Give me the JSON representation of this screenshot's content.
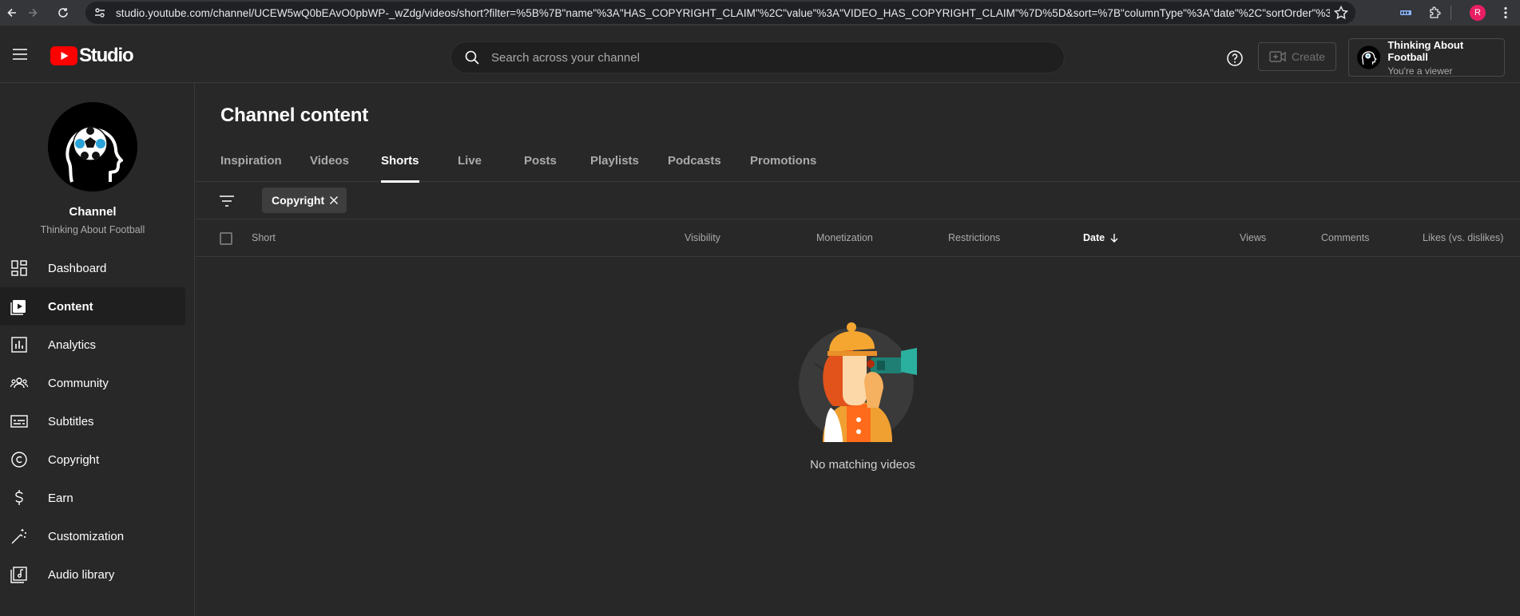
{
  "browser": {
    "url": "studio.youtube.com/channel/UCEW5wQ0bEAvO0pbWP-_wZdg/videos/short?filter=%5B%7B\"name\"%3A\"HAS_COPYRIGHT_CLAIM\"%2C\"value\"%3A\"VIDEO_HAS_COPYRIGHT_CLAIM\"%7D%5D&sort=%7B\"columnType\"%3A\"date\"%2C\"sortOrder\"%3A\"...",
    "profile_initial": "R"
  },
  "header": {
    "logo_text": "Studio",
    "search_placeholder": "Search across your channel",
    "create_label": "Create",
    "account_name": "Thinking About Football",
    "account_role": "You're a viewer"
  },
  "sidebar": {
    "channel_title": "Channel",
    "channel_name": "Thinking About Football",
    "items": [
      {
        "label": "Dashboard",
        "icon": "dashboard-icon"
      },
      {
        "label": "Content",
        "icon": "content-icon",
        "active": true
      },
      {
        "label": "Analytics",
        "icon": "analytics-icon"
      },
      {
        "label": "Community",
        "icon": "community-icon"
      },
      {
        "label": "Subtitles",
        "icon": "subtitles-icon"
      },
      {
        "label": "Copyright",
        "icon": "copyright-icon"
      },
      {
        "label": "Earn",
        "icon": "earn-icon"
      },
      {
        "label": "Customization",
        "icon": "customization-icon"
      },
      {
        "label": "Audio library",
        "icon": "audio-library-icon"
      }
    ]
  },
  "main": {
    "page_title": "Channel content",
    "tabs": [
      {
        "label": "Inspiration"
      },
      {
        "label": "Videos"
      },
      {
        "label": "Shorts",
        "active": true
      },
      {
        "label": "Live"
      },
      {
        "label": "Posts"
      },
      {
        "label": "Playlists"
      },
      {
        "label": "Podcasts"
      },
      {
        "label": "Promotions"
      }
    ],
    "filter_chip": "Copyright",
    "columns": {
      "short": "Short",
      "visibility": "Visibility",
      "monetization": "Monetization",
      "restrictions": "Restrictions",
      "date": "Date",
      "views": "Views",
      "comments": "Comments",
      "likes": "Likes (vs. dislikes)"
    },
    "empty_message": "No matching videos"
  },
  "colors": {
    "background": "#282828",
    "brand_red": "#ff0000",
    "text_secondary": "#aaaaaa"
  }
}
